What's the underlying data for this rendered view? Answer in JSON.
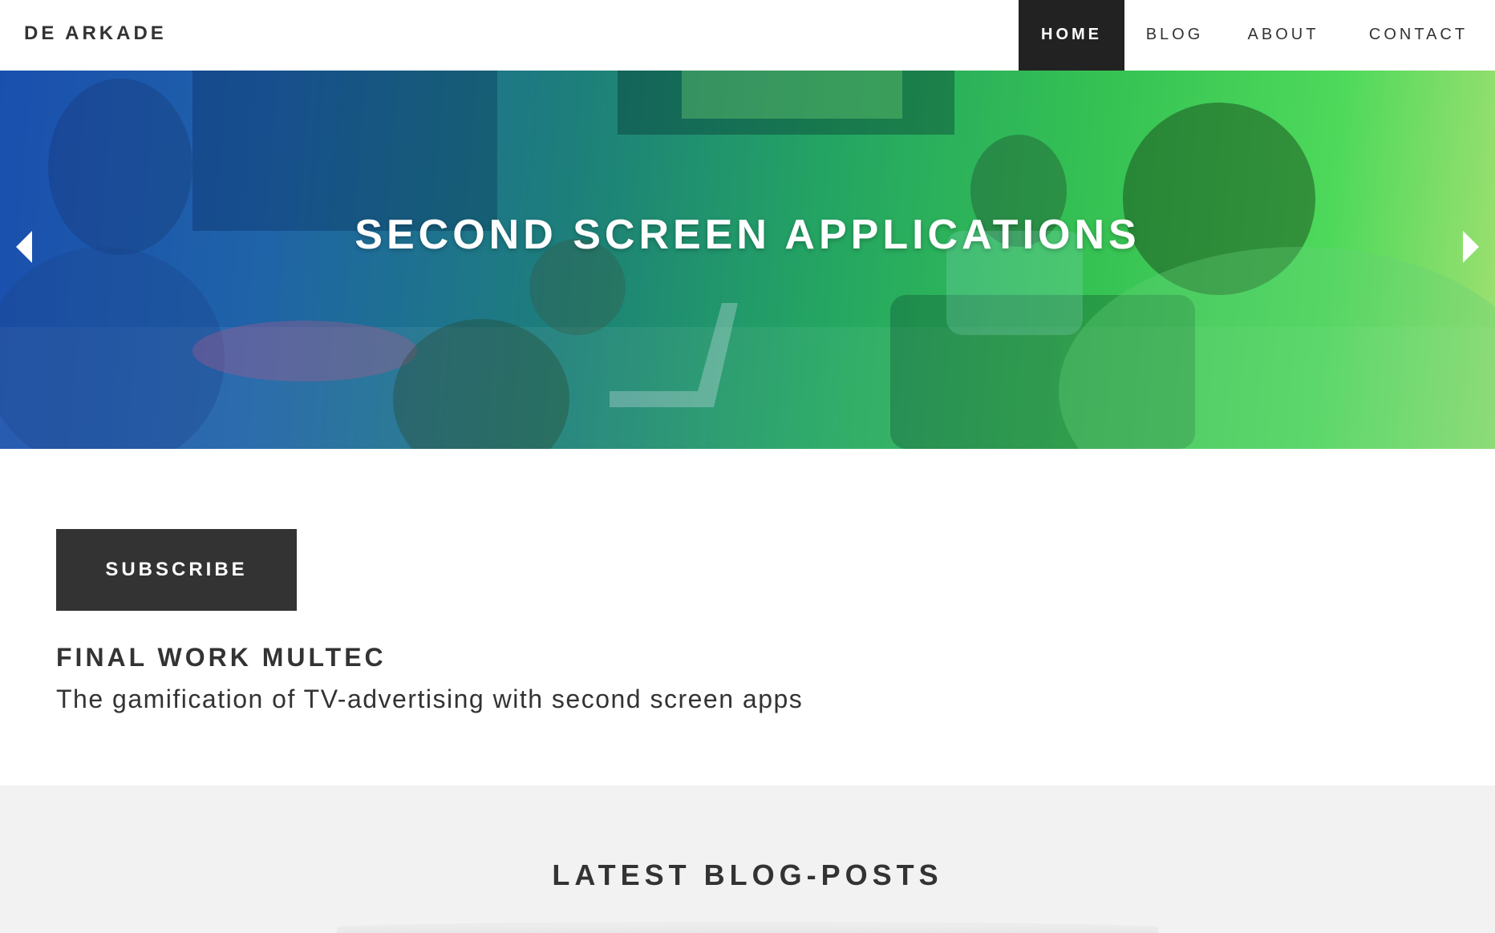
{
  "brand": {
    "name": "DE ARKADE"
  },
  "nav": {
    "items": [
      {
        "label": "HOME",
        "active": true
      },
      {
        "label": "BLOG",
        "active": false
      },
      {
        "label": "ABOUT",
        "active": false
      },
      {
        "label": "CONTACT",
        "active": false
      }
    ]
  },
  "hero": {
    "title": "SECOND SCREEN APPLICATIONS",
    "prev_icon": "caret-left-icon",
    "next_icon": "caret-right-icon",
    "gradient_colors": [
      "#1a4fae",
      "#24a562",
      "#4ed95b",
      "#9fe071"
    ]
  },
  "main": {
    "subscribe_label": "SUBSCRIBE",
    "heading": "FINAL WORK MULTEC",
    "subheading": "The gamification of TV-advertising with second screen apps"
  },
  "blog": {
    "heading": "LATEST BLOG-POSTS"
  },
  "colors": {
    "dark": "#333333",
    "nav_active_bg": "#222222",
    "section_bg": "#f2f2f2"
  }
}
